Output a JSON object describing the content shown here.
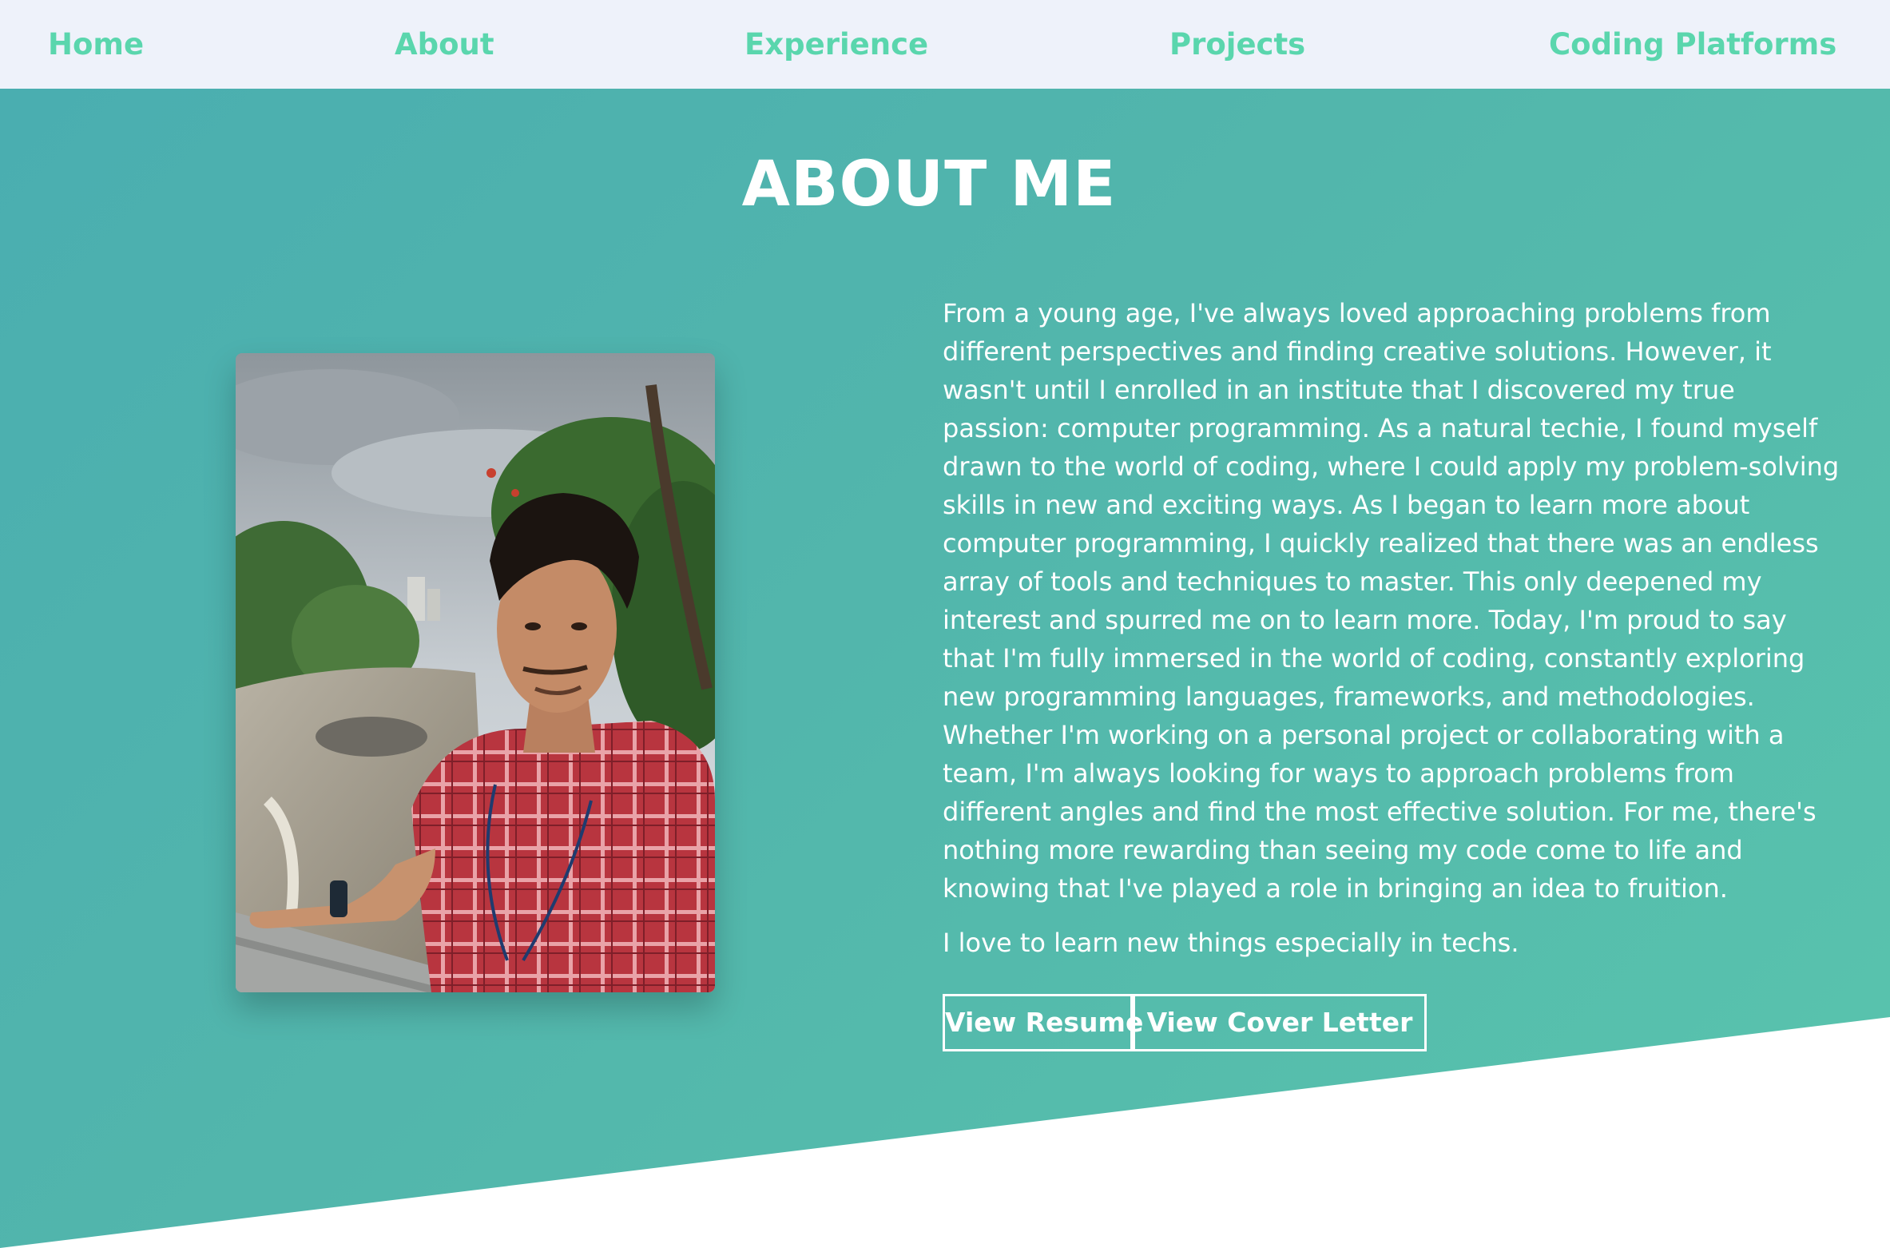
{
  "nav": {
    "items": [
      {
        "label": "Home"
      },
      {
        "label": "About"
      },
      {
        "label": "Experience"
      },
      {
        "label": "Projects"
      },
      {
        "label": "Coding Platforms"
      }
    ]
  },
  "about": {
    "title": "ABOUT ME",
    "paragraph1": "From a young age, I've always loved approaching problems from different perspectives and finding creative solutions. However, it wasn't until I enrolled in an institute that I discovered my true passion: computer programming. As a natural techie, I found myself drawn to the world of coding, where I could apply my problem-solving skills in new and exciting ways. As I began to learn more about computer programming, I quickly realized that there was an endless array of tools and techniques to master. This only deepened my interest and spurred me on to learn more. Today, I'm proud to say that I'm fully immersed in the world of coding, constantly exploring new programming languages, frameworks, and methodologies. Whether I'm working on a personal project or collaborating with a team, I'm always looking for ways to approach problems from different angles and find the most effective solution. For me, there's nothing more rewarding than seeing my code come to life and knowing that I've played a role in bringing an idea to fruition.",
    "paragraph2": "I love to learn new things especially in techs.",
    "buttons": {
      "resume": "View Resume",
      "cover_letter": "View Cover Letter"
    }
  },
  "colors": {
    "nav_bg": "#eef2fa",
    "nav_link": "#5ad6ad",
    "hero_gradient_start": "#4aaeb0",
    "hero_gradient_end": "#59c4ad",
    "text": "#ffffff"
  }
}
